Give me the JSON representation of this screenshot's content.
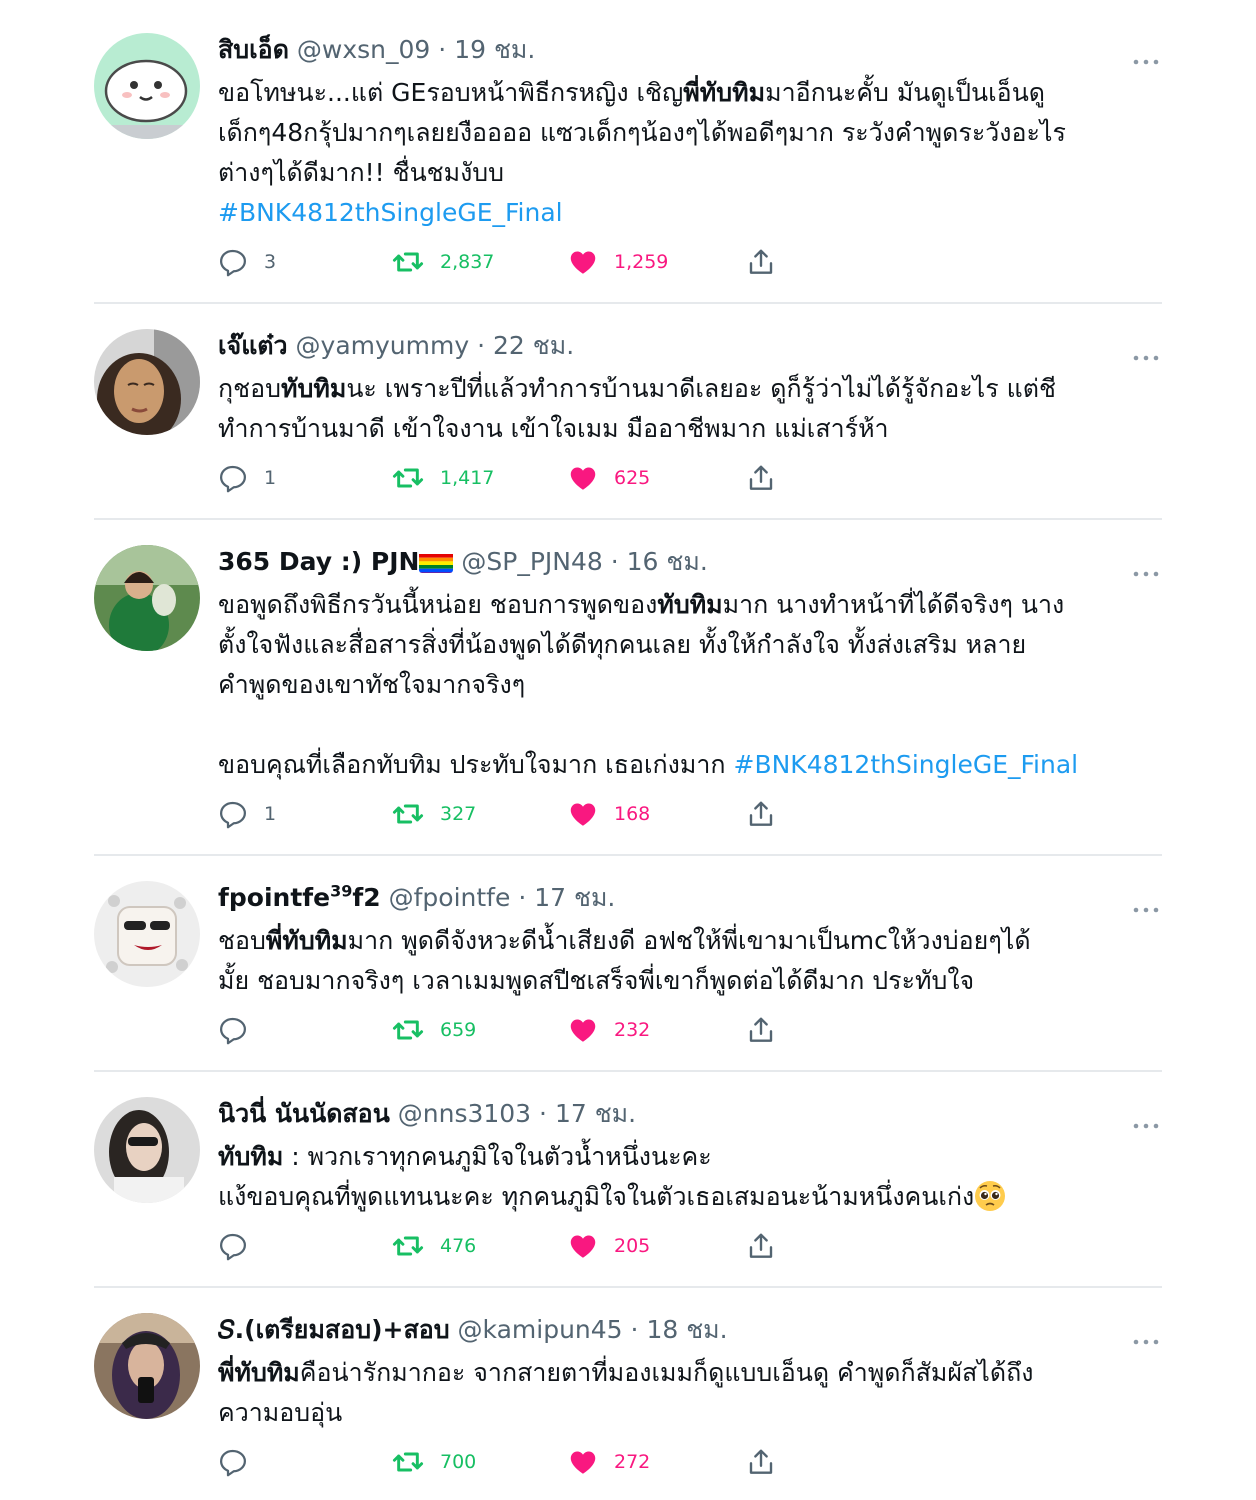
{
  "tweets": [
    {
      "name": "สิบเอ็ด",
      "handle": "@wxsn_09",
      "separator": "·",
      "time": "19 ชม.",
      "lines": [
        [
          "ขอโทษนะ...แต่ GEรอบหน้าพิธีกรหญิง เชิญ",
          "พี่ทับทิม",
          "มาอีกนะคั้บ มันดูเป็นเอ็นดู"
        ],
        "เด็กๆ48กรุ้ปมากๆเลยยงืออออ แซวเด็กๆน้องๆได้พอดีๆมาก ระวังคำพูดระวังอะไร",
        "ต่างๆได้ดีมาก!! ชื่นชมงับบ"
      ],
      "hashtag": "#BNK4812thSingleGE_Final",
      "replies": "3",
      "retweets": "2,837",
      "likes": "1,259"
    },
    {
      "name": "เจ๊แต๋ว",
      "handle": "@yamyummy",
      "separator": "·",
      "time": "22 ชม.",
      "lines": [
        [
          "กุชอบ",
          "ทับทิม",
          "นะ เพราะปีที่แล้วทำการบ้านมาดีเลยอะ ดูก็รู้ว่าไม่ได้รู้จักอะไร แต่ชี"
        ],
        "ทำการบ้านมาดี เข้าใจงาน เข้าใจเมม มืออาชีพมาก แม่เสาร์ห้า"
      ],
      "replies": "1",
      "retweets": "1,417",
      "likes": "625"
    },
    {
      "name": "365 Day :) PJN",
      "handle": "@SP_PJN48",
      "separator": "·",
      "time": "16 ชม.",
      "lines": [
        [
          "ขอพูดถึงพิธีกรวันนี้หน่อย ชอบการพูดของ",
          "ทับทิม",
          "มาก นางทำหน้าที่ได้ดีจริงๆ นาง"
        ],
        "ตั้งใจฟังและสื่อสารสิ่งที่น้องพูดได้ดีทุกคนเลย ทั้งให้กำลังใจ ทั้งส่งเสริม หลาย",
        "คำพูดของเขาทัชใจมากจริงๆ"
      ],
      "extra_line": "ขอบคุณที่เลือกทับทิม ประทับใจมาก เธอเก่งมาก",
      "hashtag": "#BNK4812thSingleGE_Final",
      "replies": "1",
      "retweets": "327",
      "likes": "168"
    },
    {
      "name": "fpointfe",
      "name_sup": "39",
      "name_tail": "f2",
      "handle": "@fpointfe",
      "separator": "·",
      "time": "17 ชม.",
      "lines": [
        [
          "ชอบ",
          "พี่ทับทิม",
          "มาก พูดดีจังหวะดีน้ำเสียงดี อฟชให้พี่เขามาเป็นmcให้วงบ่อยๆได้"
        ],
        "มั้ย ชอบมากจริงๆ เวลาเมมพูดสปีชเสร็จพี่เขาก็พูดต่อได้ดีมาก ประทับใจ"
      ],
      "replies": "",
      "retweets": "659",
      "likes": "232"
    },
    {
      "name": "นิวนี่ นันนัดสอน",
      "handle": "@nns3103",
      "separator": "·",
      "time": "17 ชม.",
      "lines": [
        [
          "",
          "ทับทิม",
          " : พวกเราทุกคนภูมิใจในตัวน้ำหนึ่งนะคะ"
        ],
        "แง้ขอบคุณที่พูดแทนนะคะ ทุกคนภูมิใจในตัวเธอเสมอนะน้ามหนึ่งคนเก่ง"
      ],
      "replies": "",
      "retweets": "476",
      "likes": "205"
    },
    {
      "name": "𝑆.(เตรียมสอบ)+สอบ",
      "handle": "@kamipun45",
      "separator": "·",
      "time": "18 ชม.",
      "lines": [
        [
          "",
          "พี่ทับทิม",
          "คือน่ารักมากอะ จากสายตาที่มองเมมก็ดูแบบเอ็นดู คำพูดก็สัมผัสได้ถึง"
        ],
        "ความอบอุ่น"
      ],
      "replies": "",
      "retweets": "700",
      "likes": "272"
    }
  ]
}
